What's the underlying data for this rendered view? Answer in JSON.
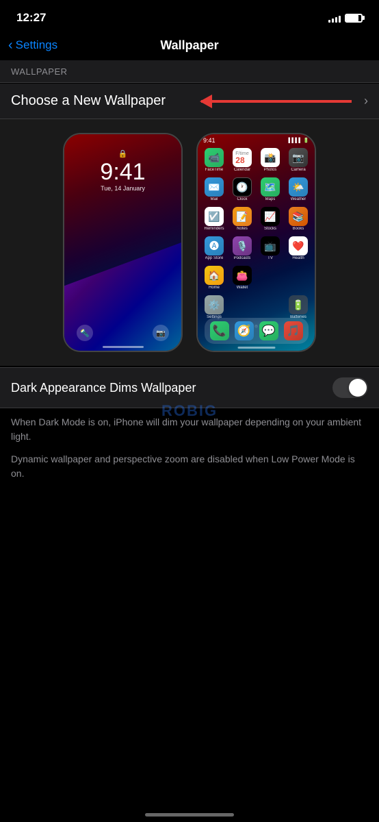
{
  "status_bar": {
    "time": "12:27",
    "signal_bars": [
      4,
      6,
      8,
      10,
      12
    ],
    "battery_percent": 80
  },
  "nav": {
    "back_label": "Settings",
    "title": "Wallpaper"
  },
  "section_header": "WALLPAPER",
  "choose_row": {
    "label": "Choose a New Wallpaper",
    "chevron": "›"
  },
  "lock_screen": {
    "time": "9:41",
    "date": "Tue, 14 January"
  },
  "home_screen": {
    "time": "9:41",
    "apps_row1": [
      {
        "label": "FaceTime",
        "class": "app-facetime"
      },
      {
        "label": "Calendar",
        "class": "app-calendar"
      },
      {
        "label": "Photos",
        "class": "app-photos"
      },
      {
        "label": "Camera",
        "class": "app-camera"
      }
    ],
    "apps_row2": [
      {
        "label": "Mail",
        "class": "app-mail"
      },
      {
        "label": "Clock",
        "class": "app-clock"
      },
      {
        "label": "Maps",
        "class": "app-maps"
      },
      {
        "label": "Weather",
        "class": "app-weather"
      }
    ],
    "apps_row3": [
      {
        "label": "Reminders",
        "class": "app-reminders"
      },
      {
        "label": "Notes",
        "class": "app-notes"
      },
      {
        "label": "Stocks",
        "class": "app-stocks"
      },
      {
        "label": "Books",
        "class": "app-books"
      }
    ],
    "apps_row4": [
      {
        "label": "App Store",
        "class": "app-appstore"
      },
      {
        "label": "Podcasts",
        "class": "app-podcasts"
      },
      {
        "label": "TV",
        "class": "app-appletv"
      },
      {
        "label": "Health",
        "class": "app-health"
      }
    ],
    "apps_row5": [
      {
        "label": "Home",
        "class": "app-home"
      },
      {
        "label": "Wallet",
        "class": "app-wallet"
      },
      {
        "label": "",
        "class": ""
      },
      {
        "label": "",
        "class": ""
      }
    ],
    "apps_row6": [
      {
        "label": "Settings",
        "class": "app-settings"
      },
      {
        "label": "",
        "class": ""
      },
      {
        "label": "",
        "class": ""
      },
      {
        "label": "Batteries",
        "class": "app-batteries"
      }
    ],
    "dock": [
      "📞",
      "🌐",
      "💬",
      "🎵"
    ]
  },
  "dark_appearance": {
    "label": "Dark Appearance Dims Wallpaper",
    "toggle_on": false
  },
  "footer": {
    "text1": "When Dark Mode is on, iPhone will dim your wallpaper depending on your ambient light.",
    "text2": "Dynamic wallpaper and perspective zoom are disabled when Low Power Mode is on."
  },
  "watermark": "ROBIG"
}
